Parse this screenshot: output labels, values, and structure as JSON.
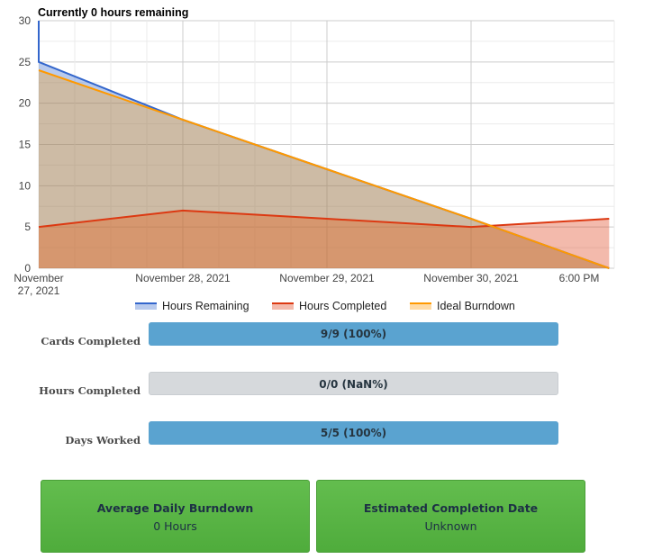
{
  "chart_data": {
    "type": "area",
    "title": "Currently 0 hours remaining",
    "xlabel": "",
    "ylabel": "",
    "x_ticks": [
      "November 27, 2021",
      "November 28, 2021",
      "November 29, 2021",
      "November 30, 2021",
      "6:00 PM"
    ],
    "y_ticks": [
      "0",
      "5",
      "10",
      "15",
      "20",
      "25",
      "30"
    ],
    "ylim": [
      0,
      30
    ],
    "grid": true,
    "legend_position": "bottom",
    "series": [
      {
        "name": "Hours Remaining",
        "color": "#3366cc",
        "points": [
          {
            "x": "2021-11-27T00:00",
            "y": 30
          },
          {
            "x": "2021-11-27T00:00",
            "y": 25
          },
          {
            "x": "2021-11-28T00:00",
            "y": 18
          },
          {
            "x": "2021-11-29T00:00",
            "y": 12
          },
          {
            "x": "2021-11-30T00:00",
            "y": 6
          },
          {
            "x": "2021-11-30T23:00",
            "y": 0
          }
        ]
      },
      {
        "name": "Hours Completed",
        "color": "#dc3912",
        "points": [
          {
            "x": "2021-11-27T00:00",
            "y": 5
          },
          {
            "x": "2021-11-28T00:00",
            "y": 7
          },
          {
            "x": "2021-11-29T00:00",
            "y": 6
          },
          {
            "x": "2021-11-30T00:00",
            "y": 5
          },
          {
            "x": "2021-11-30T23:00",
            "y": 6
          }
        ]
      },
      {
        "name": "Ideal Burndown",
        "color": "#ff9900",
        "points": [
          {
            "x": "2021-11-27T00:00",
            "y": 24
          },
          {
            "x": "2021-11-28T00:00",
            "y": 18
          },
          {
            "x": "2021-11-29T00:00",
            "y": 12
          },
          {
            "x": "2021-11-30T00:00",
            "y": 6
          },
          {
            "x": "2021-11-30T23:00",
            "y": 0
          }
        ]
      }
    ]
  },
  "progress": {
    "cards": {
      "label": "Cards Completed",
      "text": "9/9 (100%)",
      "fraction": 1.0
    },
    "hours": {
      "label": "Hours Completed",
      "text": "0/0 (NaN%)",
      "fraction": 0
    },
    "days": {
      "label": "Days Worked",
      "text": "5/5 (100%)",
      "fraction": 1.0
    }
  },
  "summary": {
    "burndown": {
      "title": "Average Daily Burndown",
      "value": "0 Hours"
    },
    "completion": {
      "title": "Estimated Completion Date",
      "value": "Unknown"
    }
  },
  "colors": {
    "progress_fill": "#5aa3d0",
    "progress_empty": "#d6d9dc",
    "card": "#56b343"
  }
}
